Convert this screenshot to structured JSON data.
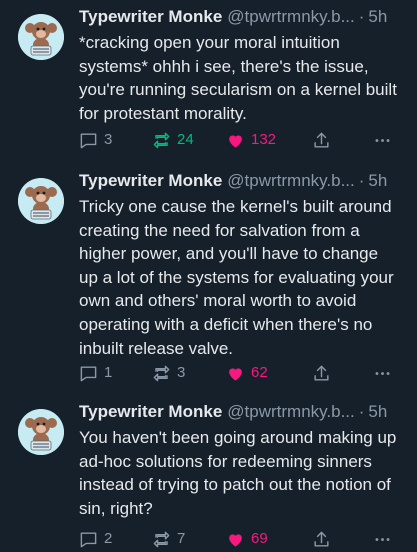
{
  "colors": {
    "background": "#15202b",
    "text": "#e7e9ea",
    "muted": "#8b98a5",
    "retweet_active": "#00ba7c",
    "like_active": "#f91880"
  },
  "tweets": [
    {
      "author": {
        "display_name": "Typewriter Monke",
        "handle": "@tpwrtrmnky.b...",
        "separator": "·",
        "time": "5h"
      },
      "text": "*cracking open your moral intuition systems* ohhh i see, there's the issue, you're running secularism on a kernel built for protestant morality.",
      "actions": {
        "replies": "3",
        "retweets": "24",
        "likes": "132",
        "retweeted": true,
        "liked": true
      }
    },
    {
      "author": {
        "display_name": "Typewriter Monke",
        "handle": "@tpwrtrmnky.b...",
        "separator": "·",
        "time": "5h"
      },
      "text": "Tricky one cause the kernel's built around creating the need for salvation from a higher power, and you'll have to change up a lot of the systems for evaluating your own and others' moral worth to avoid operating with a deficit when there's no inbuilt release valve.",
      "actions": {
        "replies": "1",
        "retweets": "3",
        "likes": "62",
        "retweeted": false,
        "liked": true
      }
    },
    {
      "author": {
        "display_name": "Typewriter Monke",
        "handle": "@tpwrtrmnky.b...",
        "separator": "·",
        "time": "5h"
      },
      "text": "You haven't been going around making up ad-hoc solutions for redeeming sinners instead of trying to patch out the notion of sin, right?",
      "actions": {
        "replies": "2",
        "retweets": "7",
        "likes": "69",
        "retweeted": false,
        "liked": true
      }
    }
  ],
  "icons": {
    "reply": "speech-bubble-icon",
    "retweet": "retweet-arrows-icon",
    "like": "heart-icon",
    "share": "share-upload-icon",
    "more": "more-dots-icon",
    "avatar": "monkey-avatar"
  }
}
